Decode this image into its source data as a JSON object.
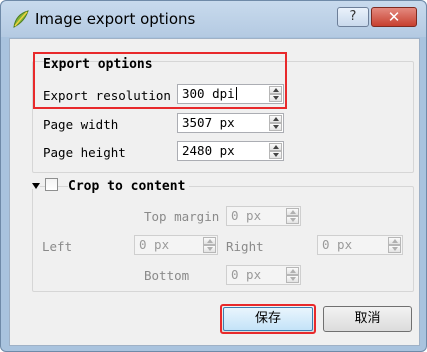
{
  "window": {
    "title": "Image export options",
    "help_button": "?",
    "close_button": "✕"
  },
  "export_options": {
    "group_title": "Export options",
    "resolution_label": "Export resolution",
    "resolution_value": "300 dpi",
    "page_width_label": "Page width",
    "page_width_value": "3507 px",
    "page_height_label": "Page height",
    "page_height_value": "2480 px"
  },
  "crop": {
    "group_title": "Crop to content",
    "checked": false,
    "top_label": "Top margin",
    "top_value": "0 px",
    "left_label": "Left",
    "left_value": "0 px",
    "right_label": "Right",
    "right_value": "0 px",
    "bottom_label": "Bottom",
    "bottom_value": "0 px"
  },
  "buttons": {
    "save": "保存",
    "cancel": "取消"
  },
  "colors": {
    "highlight": "#e8292b",
    "titlebar": "#b4cae2"
  }
}
